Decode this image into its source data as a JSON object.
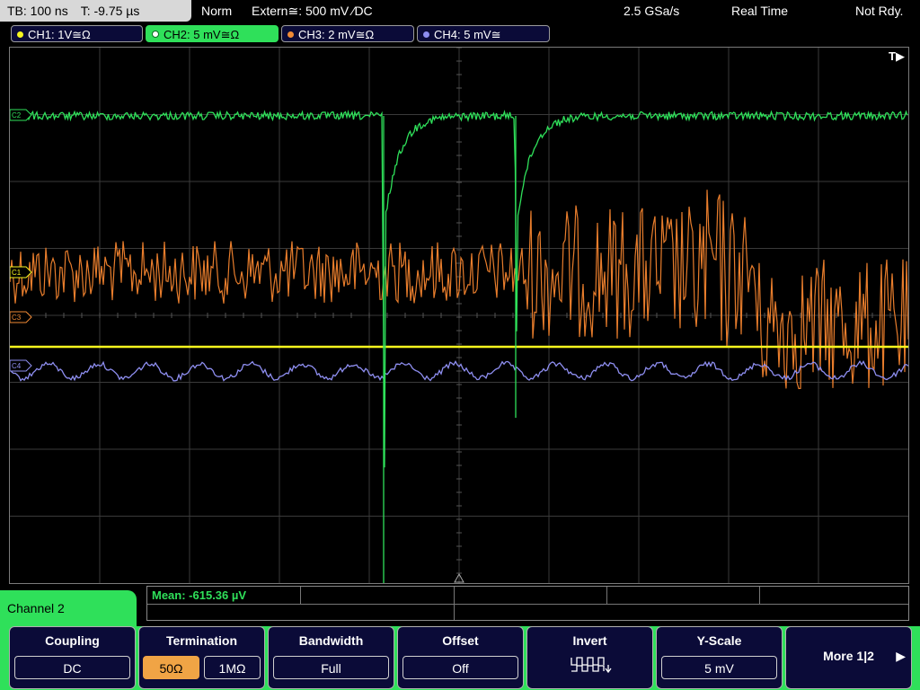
{
  "topbar": {
    "timebase": "TB: 100 ns",
    "trigger_time": "T: -9.75 µs",
    "mode": "Norm",
    "trigger_source": "Extern≅: 500 mV ⁄DC",
    "sample_rate": "2.5 GSa/s",
    "acq_mode": "Real Time",
    "status": "Not Rdy."
  },
  "channels": [
    {
      "label": "CH1: 1V≅Ω",
      "color": "#f5f51e"
    },
    {
      "label": "CH2: 5 mV≅Ω",
      "color": "#2fe05a"
    },
    {
      "label": "CH3: 2 mV≅Ω",
      "color": "#f08a35"
    },
    {
      "label": "CH4: 5 mV≅",
      "color": "#8e8ef0"
    }
  ],
  "display": {
    "trigger_marker": "T▶",
    "ch_markers": [
      "C2",
      "C1",
      "C3",
      "C4"
    ]
  },
  "measurement": {
    "text": "Mean: -615.36 µV"
  },
  "channel_panel": {
    "title": "Channel 2"
  },
  "softkeys": {
    "coupling": {
      "title": "Coupling",
      "value": "DC"
    },
    "termination": {
      "title": "Termination",
      "options": [
        "50Ω",
        "1MΩ"
      ],
      "selected": "50Ω"
    },
    "bandwidth": {
      "title": "Bandwidth",
      "value": "Full"
    },
    "offset": {
      "title": "Offset",
      "value": "Off"
    },
    "invert": {
      "title": "Invert",
      "icon": "invert-waveform-icon"
    },
    "yscale": {
      "title": "Y-Scale",
      "value": "5 mV"
    },
    "more": {
      "label": "More 1|2",
      "arrow": "▶"
    }
  }
}
